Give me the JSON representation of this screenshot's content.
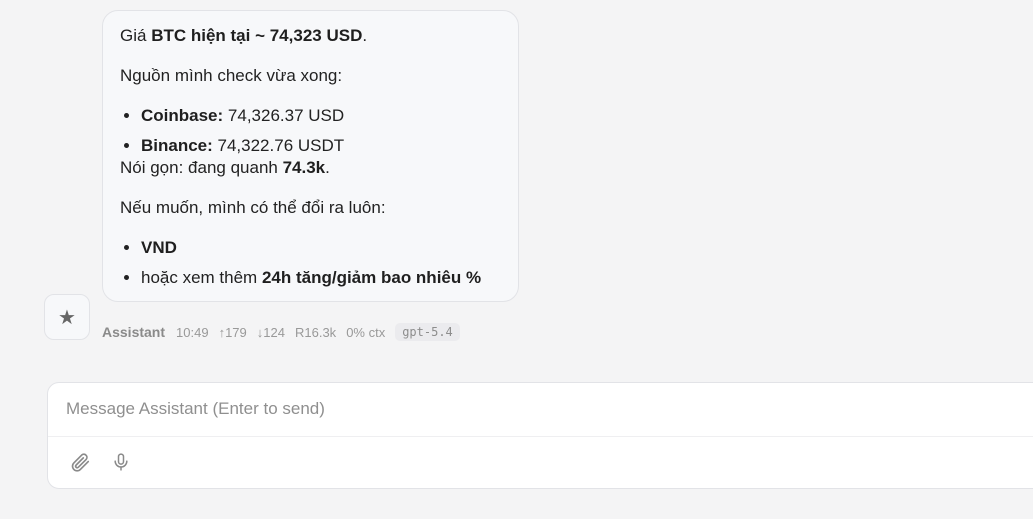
{
  "message": {
    "line1_prefix": "Giá ",
    "line1_bold": "BTC hiện tại ~ 74,323 USD",
    "line1_suffix": ".",
    "sources_intro": "Nguồn mình check vừa xong:",
    "sources": [
      {
        "name": "Coinbase:",
        "value": " 74,326.37 USD"
      },
      {
        "name": "Binance:",
        "value": " 74,322.76 USDT"
      }
    ],
    "summary_prefix": "Nói gọn: đang quanh ",
    "summary_bold": "74.3k",
    "summary_suffix": ".",
    "offer_intro": "Nếu muốn, mình có thể đổi ra luôn:",
    "options": [
      {
        "prefix": "",
        "bold": "VND"
      },
      {
        "prefix": "hoặc xem thêm ",
        "bold": "24h tăng/giảm bao nhiêu %"
      }
    ]
  },
  "meta": {
    "sender": "Assistant",
    "time": "10:49",
    "tokens_up": "↑179",
    "tokens_down": "↓124",
    "reads": "R16.3k",
    "ctx": "0% ctx",
    "model": "gpt-5.4"
  },
  "composer": {
    "placeholder": "Message Assistant (Enter to send)"
  },
  "icons": {
    "avatar": "star-icon",
    "attach": "paperclip-icon",
    "mic": "microphone-icon"
  }
}
